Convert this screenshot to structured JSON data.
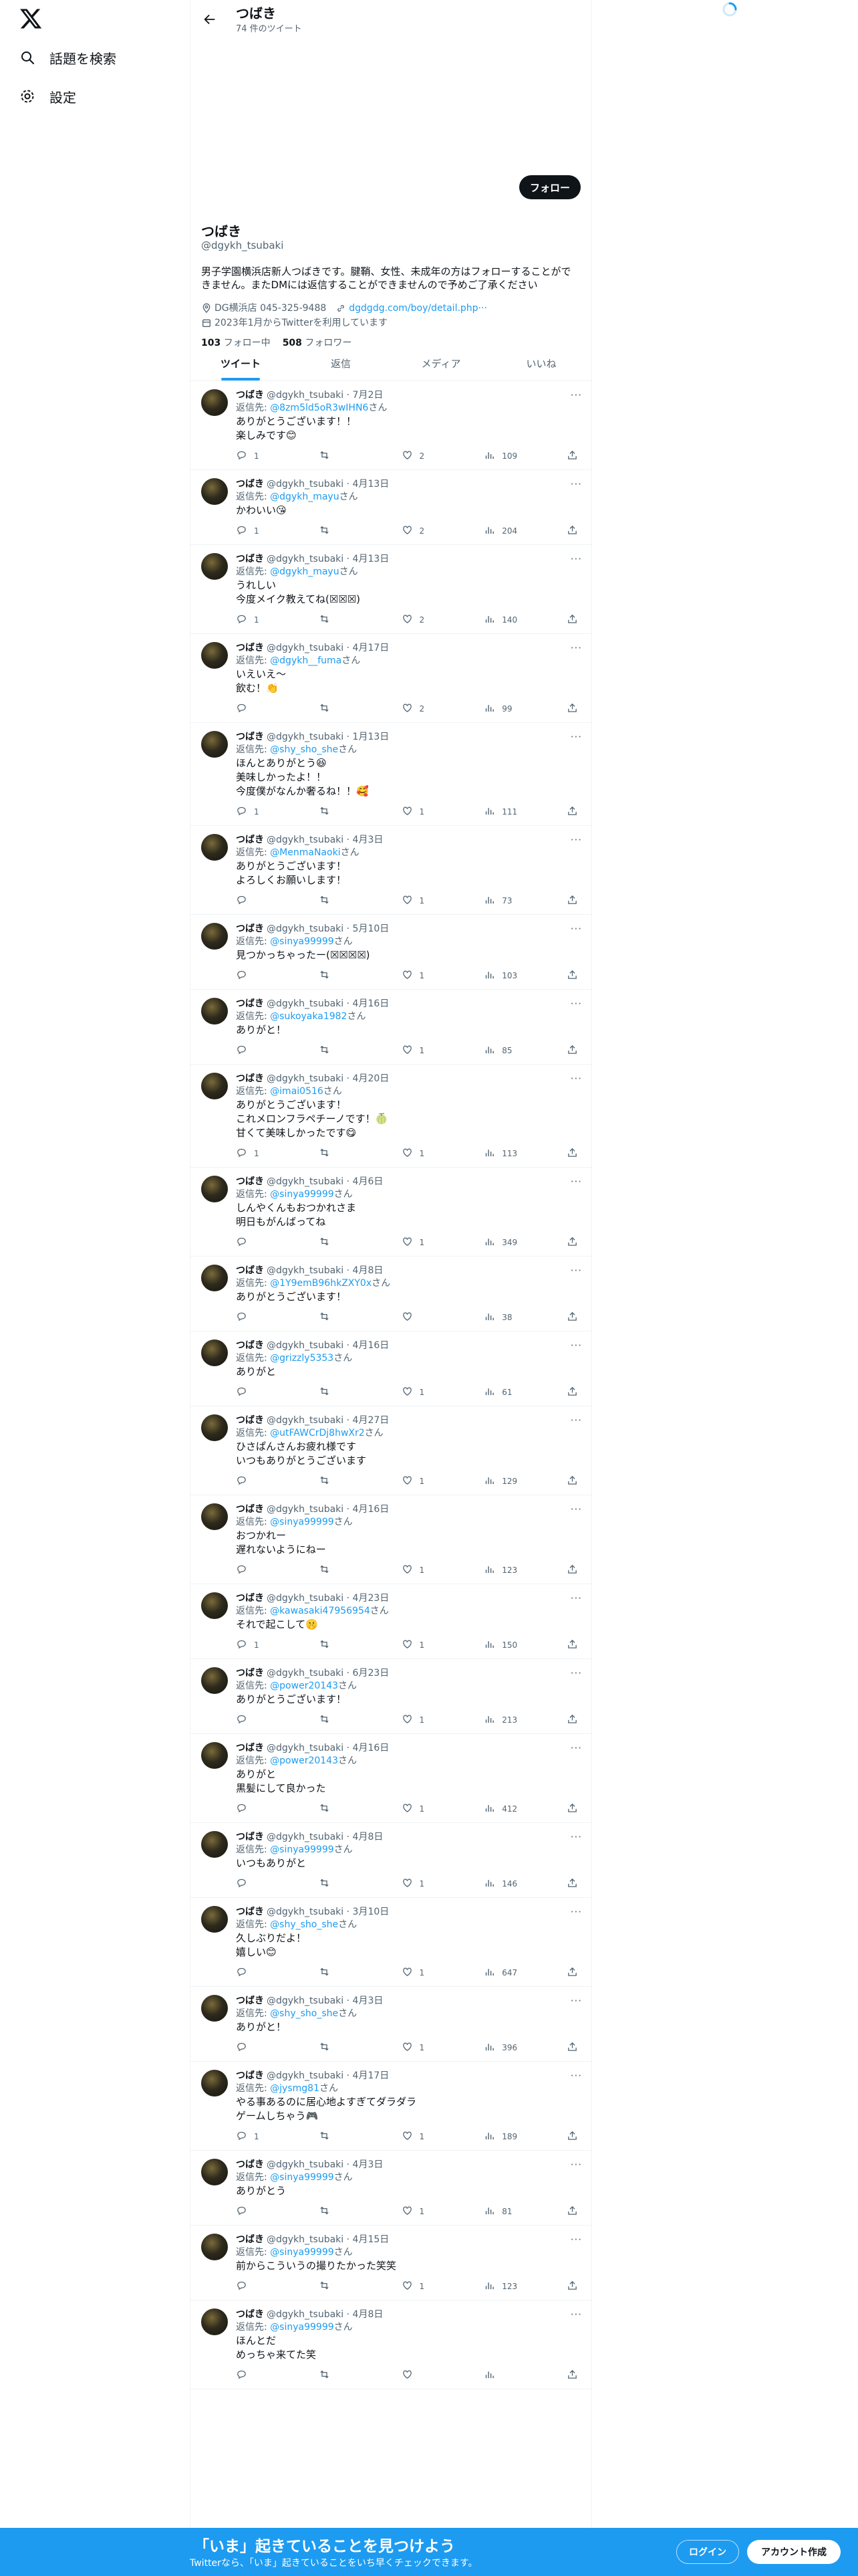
{
  "nav": {
    "explore_label": "話題を検索",
    "settings_label": "設定"
  },
  "header": {
    "title": "つばき",
    "tweet_count": "74 件のツイート"
  },
  "profile": {
    "follow_label": "フォロー",
    "name": "つばき",
    "handle": "@dgykh_tsubaki",
    "bio": "男子学園横浜店新人つばきです。腱鞘、女性、未成年の方はフォローすることができません。またDMには返信することができませんので予めご了承ください",
    "location": "DG横浜店 045-325-9488",
    "url": "dgdgdg.com/boy/detail.php···",
    "joined": "2023年1月からTwitterを利用しています",
    "following_count": "103",
    "following_label": "フォロー中",
    "followers_count": "508",
    "followers_label": "フォロワー"
  },
  "tabs": [
    "ツイート",
    "返信",
    "メディア",
    "いいね"
  ],
  "tweets": [
    {
      "date": "7月2日",
      "to": "@8zm5ld5oR3wIHN6",
      "text": "ありがとうございます！！\n楽しみです😊",
      "replies": "1",
      "retweets": "",
      "likes": "2",
      "views": "109"
    },
    {
      "date": "4月13日",
      "to": "@dgykh_mayu",
      "text": "かわいい😘",
      "replies": "1",
      "retweets": "",
      "likes": "2",
      "views": "204"
    },
    {
      "date": "4月13日",
      "to": "@dgykh_mayu",
      "text": "うれしい\n今度メイク教えてね(☒☒☒)",
      "replies": "1",
      "retweets": "",
      "likes": "2",
      "views": "140"
    },
    {
      "date": "4月17日",
      "to": "@dgykh__fuma",
      "text": "いえいえ〜\n飲む！👏",
      "replies": "",
      "retweets": "",
      "likes": "2",
      "views": "99"
    },
    {
      "date": "1月13日",
      "to": "@shy_sho_she",
      "text": "ほんとありがとう😆\n美味しかったよ！！\n今度僕がなんか奢るね！！🥰",
      "replies": "1",
      "retweets": "",
      "likes": "1",
      "views": "111"
    },
    {
      "date": "4月3日",
      "to": "@MenmaNaoki",
      "text": "ありがとうございます！\nよろしくお願いします！",
      "replies": "",
      "retweets": "",
      "likes": "1",
      "views": "73"
    },
    {
      "date": "5月10日",
      "to": "@sinya99999",
      "text": "見つかっちゃったー(☒☒☒☒)",
      "replies": "",
      "retweets": "",
      "likes": "1",
      "views": "103"
    },
    {
      "date": "4月16日",
      "to": "@sukoyaka1982",
      "text": "ありがと！",
      "replies": "",
      "retweets": "",
      "likes": "1",
      "views": "85"
    },
    {
      "date": "4月20日",
      "to": "@imai0516",
      "text": "ありがとうございます！\nこれメロンフラペチーノです！🍈\n甘くて美味しかったです😋",
      "replies": "1",
      "retweets": "",
      "likes": "1",
      "views": "113"
    },
    {
      "date": "4月6日",
      "to": "@sinya99999",
      "text": "しんやくんもおつかれさま\n明日もがんばってね",
      "replies": "",
      "retweets": "",
      "likes": "1",
      "views": "349"
    },
    {
      "date": "4月8日",
      "to": "@1Y9emB96hkZXY0x",
      "text": "ありがとうございます！",
      "replies": "",
      "retweets": "",
      "likes": "",
      "views": "38"
    },
    {
      "date": "4月16日",
      "to": "@grizzly5353",
      "text": "ありがと",
      "replies": "",
      "retweets": "",
      "likes": "1",
      "views": "61"
    },
    {
      "date": "4月27日",
      "to": "@utFAWCrDj8hwXr2",
      "text": "ひさぱんさんお疲れ様です\nいつもありがとうございます",
      "replies": "",
      "retweets": "",
      "likes": "1",
      "views": "129"
    },
    {
      "date": "4月16日",
      "to": "@sinya99999",
      "text": "おつかれー\n遅れないようにねー",
      "replies": "",
      "retweets": "",
      "likes": "1",
      "views": "123"
    },
    {
      "date": "4月23日",
      "to": "@kawasaki47956954",
      "text": "それで起こして🤫",
      "replies": "1",
      "retweets": "",
      "likes": "1",
      "views": "150"
    },
    {
      "date": "6月23日",
      "to": "@power20143",
      "text": "ありがとうございます！",
      "replies": "",
      "retweets": "",
      "likes": "1",
      "views": "213"
    },
    {
      "date": "4月16日",
      "to": "@power20143",
      "text": "ありがと\n黒髪にして良かった",
      "replies": "",
      "retweets": "",
      "likes": "1",
      "views": "412"
    },
    {
      "date": "4月8日",
      "to": "@sinya99999",
      "text": "いつもありがと",
      "replies": "",
      "retweets": "",
      "likes": "1",
      "views": "146"
    },
    {
      "date": "3月10日",
      "to": "@shy_sho_she",
      "text": "久しぶりだよ！\n嬉しい😊",
      "replies": "",
      "retweets": "",
      "likes": "1",
      "views": "647"
    },
    {
      "date": "4月3日",
      "to": "@shy_sho_she",
      "text": "ありがと！",
      "replies": "",
      "retweets": "",
      "likes": "1",
      "views": "396"
    },
    {
      "date": "4月17日",
      "to": "@jysmg81",
      "text": "やる事あるのに居心地よすぎてダラダラ\nゲームしちゃう🎮",
      "replies": "1",
      "retweets": "",
      "likes": "1",
      "views": "189"
    },
    {
      "date": "4月3日",
      "to": "@sinya99999",
      "text": "ありがとう",
      "replies": "",
      "retweets": "",
      "likes": "1",
      "views": "81"
    },
    {
      "date": "4月15日",
      "to": "@sinya99999",
      "text": "前からこういうの撮りたかった笑笑",
      "replies": "",
      "retweets": "",
      "likes": "1",
      "views": "123"
    },
    {
      "date": "4月8日",
      "to": "@sinya99999",
      "text": "ほんとだ\nめっちゃ来てた笑",
      "replies": "",
      "retweets": "",
      "likes": "",
      "views": ""
    }
  ],
  "tweet_common": {
    "name": "つばき",
    "handle": "@dgykh_tsubaki",
    "reply_prefix": "返信先: ",
    "reply_suffix": "さん"
  },
  "bottom_bar": {
    "title": "「いま」起きていることを見つけよう",
    "subtitle": "Twitterなら、「いま」起きていることをいち早くチェックできます。",
    "login_label": "ログイン",
    "signup_label": "アカウント作成"
  },
  "colors": {
    "accent": "#1d9bf0",
    "text": "#0f1419",
    "muted": "#536471"
  }
}
